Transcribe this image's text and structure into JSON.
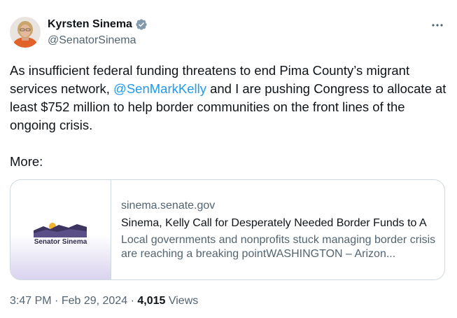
{
  "author": {
    "name": "Kyrsten Sinema",
    "handle": "@SenatorSinema"
  },
  "tweet": {
    "text_before": "As insufficient federal funding threatens to end Pima County’s migrant services network, ",
    "mention": "@SenMarkKelly",
    "text_after": " and I are pushing Congress to allocate at least $752 million to help border communities on the front lines of the ongoing crisis.",
    "more_label": "More:"
  },
  "card": {
    "logo_text": "Senator Sinema",
    "domain": "sinema.senate.gov",
    "title": "Sinema, Kelly Call for Desperately Needed Border Funds to A",
    "description": "Local governments and nonprofits stuck managing border crisis are reaching a breaking pointWASHINGTON – Arizon..."
  },
  "meta": {
    "time": "3:47 PM",
    "date": "Feb 29, 2024",
    "separator": "·",
    "views_count": "4,015",
    "views_label": "Views"
  },
  "colors": {
    "accent": "#1d9bf0",
    "secondary_text": "#536471",
    "border": "#cfd9de"
  },
  "icons": {
    "more": "more-horizontal-icon",
    "verified": "verified-badge-icon"
  }
}
